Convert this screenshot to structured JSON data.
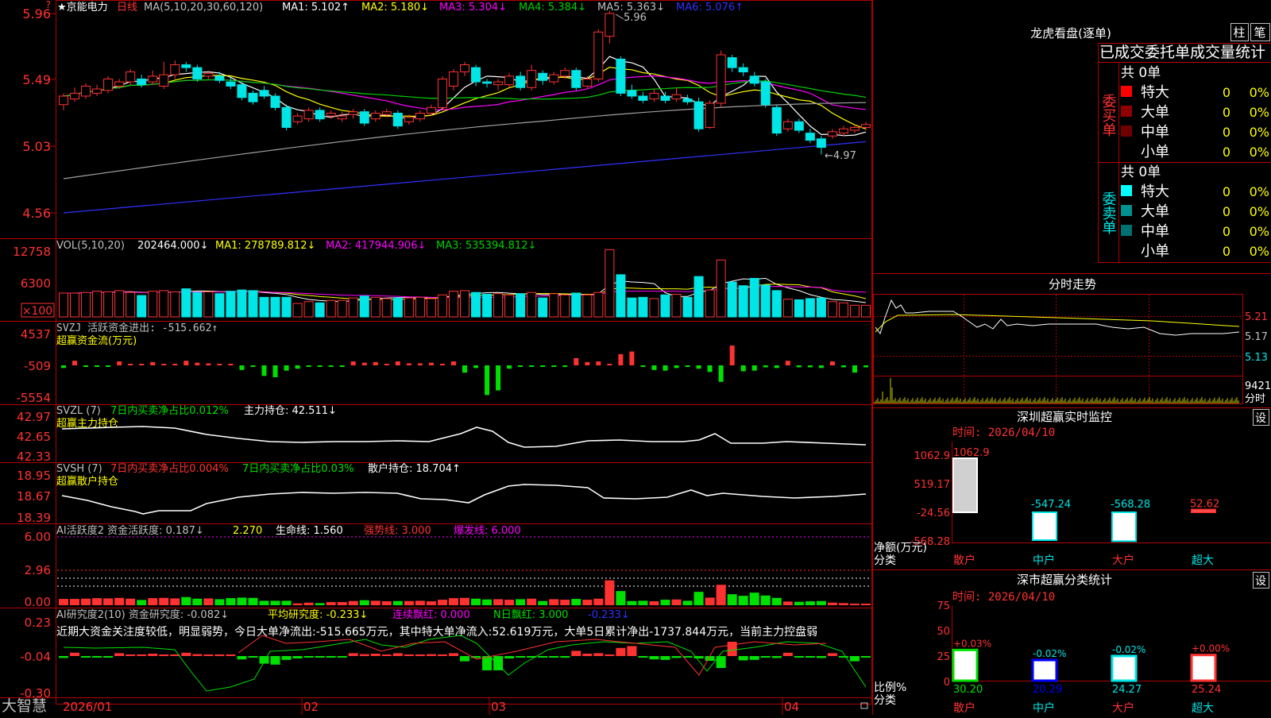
{
  "colors": {
    "up": "#ff3232",
    "down": "#00e5e5",
    "grid": "#b00000",
    "ma1": "#ffffff",
    "ma2": "#ffff00",
    "ma3": "#ff00ff",
    "ma4": "#00d000",
    "ma5": "#a0a0a0",
    "ma6": "#3030ff",
    "green": "#00e000"
  },
  "header": {
    "stock": "★京能电力",
    "period": "日线",
    "ma_def": "MA(5,10,20,30,60,120)",
    "ma1": "MA1: 5.102↑",
    "ma2": "MA2: 5.180↓",
    "ma3": "MA3: 5.304↓",
    "ma4": "MA4: 5.384↓",
    "ma5": "MA5: 5.363↓",
    "ma6": "MA6: 5.076↑"
  },
  "price_axis": [
    "5.96",
    "5.49",
    "5.03",
    "4.56"
  ],
  "price_marks": {
    "high": "5.96",
    "low": "←4.97"
  },
  "vol": {
    "def": "VOL(5,10,20)",
    "value": "202464.000↓",
    "ma1": "MA1: 278789.812↓",
    "ma2": "MA2: 417944.906↓",
    "ma3": "MA3: 535394.812↓",
    "axis": [
      "12758",
      "6300",
      "×100"
    ]
  },
  "svzj": {
    "label": "SVZJ  活跃资金进出: -515.662↑",
    "sub": "超赢资金流(万元)",
    "axis": [
      "4537",
      "-509",
      "-5554"
    ]
  },
  "svzl": {
    "label_a": "SVZL (7)",
    "label_b": "7日内买卖净占比0.012%",
    "label_c": "主力持仓: 42.511↓",
    "sub": "超赢主力持仓",
    "axis": [
      "42.97",
      "42.65",
      "42.33"
    ]
  },
  "svsh": {
    "label_a": "SVSH (7)",
    "label_b": "7日内买卖净占比0.004%",
    "label_c": "7日内买卖净占比0.03%",
    "label_d": "散户持仓: 18.704↑",
    "sub": "超赢散户持仓",
    "axis": [
      "18.95",
      "18.67",
      "18.39"
    ]
  },
  "ai1": {
    "label_a": "AI活跃度2 资金活跃度: 0.187↓",
    "label_b": "2.270",
    "label_c": "生命线: 1.560",
    "label_d": "强势线: 3.000",
    "label_e": "爆发线: 6.000",
    "axis": [
      "6.00",
      "2.96",
      "0.00"
    ]
  },
  "ai2": {
    "label_a": "AI研究度2(10) 资金研究度: -0.082↓",
    "label_b": "平均研究度: -0.233↓",
    "label_c": "连续飘红: 0.000",
    "label_d": "N日飘红: 3.000",
    "label_e": "-0.233↓",
    "commentary": "近期大资金关注度较低，明显弱势，今日大单净流出:-515.665万元，其中特大单净流入:52.619万元，大单5日累计净出-1737.844万元，当前主力控盘弱",
    "axis": [
      "0.23",
      "-0.04",
      "-0.30"
    ]
  },
  "date_axis": [
    "2026/01",
    "02",
    "03",
    "04"
  ],
  "brand": "大智慧",
  "right": {
    "lhb_title": "龙虎看盘(逐单)",
    "tab1": "柱",
    "tab2": "笔",
    "stats_header": "已成交委托单成交量统计",
    "buy_title": "委买单",
    "sell_title": "委卖单",
    "buy_total": "共 0单",
    "sell_total": "共 0单",
    "buy_rows": [
      {
        "label": "特大",
        "val": "0",
        "pct": "0%",
        "color": "#ff0000"
      },
      {
        "label": "大单",
        "val": "0",
        "pct": "0%",
        "color": "#900000"
      },
      {
        "label": "中单",
        "val": "0",
        "pct": "0%",
        "color": "#700000"
      },
      {
        "label": "小单",
        "val": "0",
        "pct": "0%",
        "color": ""
      }
    ],
    "sell_rows": [
      {
        "label": "特大",
        "val": "0",
        "pct": "0%",
        "color": "#00ffff"
      },
      {
        "label": "大单",
        "val": "0",
        "pct": "0%",
        "color": "#009090"
      },
      {
        "label": "中单",
        "val": "0",
        "pct": "0%",
        "color": "#007070"
      },
      {
        "label": "小单",
        "val": "0",
        "pct": "0%",
        "color": ""
      }
    ],
    "intraday_title": "分时走势",
    "intraday_axis": [
      "5.21",
      "5.17",
      "5.13"
    ],
    "intraday_vol": "9421",
    "intraday_tag": "分时",
    "monitor_title": "深圳超赢实时监控",
    "monitor_set": "设",
    "monitor_time": "时间: 2026/04/10",
    "monitor_axis": [
      "1062.9",
      "519.17",
      "-24.56",
      "-568.28"
    ],
    "monitor_ylabel": "净额(万元)",
    "monitor_xlabel": "分类",
    "monitor_values": [
      {
        "cat": "散户",
        "value": 1062.9,
        "label": "1062.9"
      },
      {
        "cat": "中户",
        "value": -547.24,
        "label": "-547.24"
      },
      {
        "cat": "大户",
        "value": -568.28,
        "label": "-568.28"
      },
      {
        "cat": "超大",
        "value": 52.62,
        "label": "52.62"
      }
    ],
    "class_title": "深市超赢分类统计",
    "class_set": "设",
    "class_time": "时间: 2026/04/10",
    "class_axis": [
      "75",
      "50",
      "25",
      "0"
    ],
    "class_ylabel": "比例%",
    "class_xlabel": "分类",
    "class_values": [
      {
        "cat": "散户",
        "value": 30.2,
        "label": "30.20",
        "delta": "+0.03%"
      },
      {
        "cat": "中户",
        "value": 20.29,
        "label": "20.29",
        "delta": "-0.02%"
      },
      {
        "cat": "大户",
        "value": 24.27,
        "label": "24.27",
        "delta": "-0.02%"
      },
      {
        "cat": "超大",
        "value": 25.24,
        "label": "25.24",
        "delta": "+0.00%"
      }
    ]
  },
  "chart_data": {
    "type": "candlestick",
    "dates": [
      "2026/01",
      "02",
      "03",
      "04"
    ],
    "ylim": [
      4.56,
      5.96
    ],
    "candles": [
      [
        5.32,
        5.38,
        5.28,
        5.4
      ],
      [
        5.36,
        5.4,
        5.34,
        5.44
      ],
      [
        5.38,
        5.45,
        5.36,
        5.47
      ],
      [
        5.4,
        5.43,
        5.38,
        5.46
      ],
      [
        5.42,
        5.5,
        5.4,
        5.52
      ],
      [
        5.45,
        5.48,
        5.43,
        5.5
      ],
      [
        5.48,
        5.55,
        5.46,
        5.57
      ],
      [
        5.5,
        5.46,
        5.44,
        5.53
      ],
      [
        5.48,
        5.52,
        5.46,
        5.56
      ],
      [
        5.45,
        5.53,
        5.43,
        5.62
      ],
      [
        5.53,
        5.6,
        5.5,
        5.63
      ],
      [
        5.6,
        5.58,
        5.55,
        5.62
      ],
      [
        5.58,
        5.5,
        5.48,
        5.6
      ],
      [
        5.52,
        5.54,
        5.5,
        5.56
      ],
      [
        5.52,
        5.49,
        5.47,
        5.55
      ],
      [
        5.48,
        5.45,
        5.43,
        5.51
      ],
      [
        5.46,
        5.37,
        5.35,
        5.48
      ],
      [
        5.4,
        5.34,
        5.32,
        5.42
      ],
      [
        5.42,
        5.38,
        5.36,
        5.45
      ],
      [
        5.38,
        5.3,
        5.28,
        5.4
      ],
      [
        5.3,
        5.16,
        5.14,
        5.32
      ],
      [
        5.2,
        5.24,
        5.18,
        5.26
      ],
      [
        5.22,
        5.28,
        5.2,
        5.3
      ],
      [
        5.28,
        5.22,
        5.2,
        5.3
      ],
      [
        5.24,
        5.26,
        5.22,
        5.28
      ],
      [
        5.22,
        5.24,
        5.2,
        5.27
      ],
      [
        5.25,
        5.27,
        5.22,
        5.29
      ],
      [
        5.27,
        5.19,
        5.17,
        5.29
      ],
      [
        5.22,
        5.26,
        5.2,
        5.28
      ],
      [
        5.25,
        5.27,
        5.23,
        5.29
      ],
      [
        5.26,
        5.17,
        5.15,
        5.28
      ],
      [
        5.2,
        5.23,
        5.18,
        5.25
      ],
      [
        5.22,
        5.26,
        5.2,
        5.28
      ],
      [
        5.26,
        5.3,
        5.24,
        5.32
      ],
      [
        5.3,
        5.5,
        5.28,
        5.52
      ],
      [
        5.45,
        5.55,
        5.42,
        5.57
      ],
      [
        5.55,
        5.6,
        5.52,
        5.62
      ],
      [
        5.58,
        5.48,
        5.45,
        5.6
      ],
      [
        5.48,
        5.47,
        5.44,
        5.5
      ],
      [
        5.46,
        5.48,
        5.42,
        5.5
      ],
      [
        5.46,
        5.52,
        5.44,
        5.54
      ],
      [
        5.52,
        5.44,
        5.42,
        5.55
      ],
      [
        5.44,
        5.56,
        5.42,
        5.6
      ],
      [
        5.54,
        5.49,
        5.46,
        5.56
      ],
      [
        5.48,
        5.53,
        5.46,
        5.55
      ],
      [
        5.52,
        5.56,
        5.5,
        5.58
      ],
      [
        5.56,
        5.44,
        5.42,
        5.58
      ],
      [
        5.45,
        5.5,
        5.43,
        5.52
      ],
      [
        5.5,
        5.83,
        5.48,
        5.85
      ],
      [
        5.8,
        5.96,
        5.75,
        5.98
      ],
      [
        5.64,
        5.4,
        5.38,
        5.66
      ],
      [
        5.42,
        5.38,
        5.36,
        5.46
      ],
      [
        5.38,
        5.35,
        5.33,
        5.41
      ],
      [
        5.36,
        5.4,
        5.34,
        5.43
      ],
      [
        5.38,
        5.35,
        5.33,
        5.41
      ],
      [
        5.36,
        5.39,
        5.34,
        5.44
      ],
      [
        5.36,
        5.34,
        5.32,
        5.39
      ],
      [
        5.34,
        5.15,
        5.13,
        5.37
      ],
      [
        5.16,
        5.33,
        5.15,
        5.35
      ],
      [
        5.33,
        5.67,
        5.3,
        5.7
      ],
      [
        5.65,
        5.58,
        5.55,
        5.67
      ],
      [
        5.58,
        5.55,
        5.52,
        5.61
      ],
      [
        5.52,
        5.47,
        5.45,
        5.55
      ],
      [
        5.48,
        5.32,
        5.3,
        5.5
      ],
      [
        5.3,
        5.12,
        5.1,
        5.32
      ],
      [
        5.15,
        5.2,
        5.13,
        5.22
      ],
      [
        5.2,
        5.14,
        5.12,
        5.22
      ],
      [
        5.12,
        5.07,
        5.05,
        5.15
      ],
      [
        5.08,
        5.02,
        4.97,
        5.1
      ],
      [
        5.1,
        5.13,
        5.08,
        5.15
      ],
      [
        5.12,
        5.15,
        5.1,
        5.17
      ],
      [
        5.14,
        5.16,
        5.12,
        5.18
      ],
      [
        5.16,
        5.18,
        5.14,
        5.2
      ]
    ],
    "volume": [
      3.9,
      3.9,
      4.0,
      4.2,
      4.1,
      4.3,
      4.0,
      3.5,
      4.2,
      4.3,
      4.1,
      4.6,
      4.0,
      4.1,
      3.8,
      4.2,
      4.4,
      4.3,
      3.2,
      3.2,
      3.2,
      2.2,
      2.5,
      2.3,
      2.7,
      2.7,
      3.1,
      3.4,
      3.2,
      3.0,
      3.1,
      3.1,
      3.2,
      3.0,
      3.6,
      4.2,
      4.3,
      4.0,
      3.7,
      3.8,
      3.6,
      3.8,
      4.0,
      3.1,
      3.8,
      3.6,
      3.9,
      3.6,
      4.0,
      11.0,
      6.9,
      3.1,
      3.2,
      3.0,
      3.6,
      3.7,
      3.2,
      6.6,
      4.4,
      9.3,
      5.7,
      5.1,
      6.3,
      5.2,
      4.3,
      2.9,
      2.8,
      3.0,
      3.1,
      2.5,
      2.3,
      1.9,
      1.9
    ],
    "flow": [
      -400,
      700,
      -100,
      -200,
      -100,
      600,
      200,
      100,
      500,
      100,
      100,
      700,
      400,
      300,
      100,
      100,
      -700,
      -100,
      -1600,
      -1800,
      -800,
      -500,
      -200,
      -100,
      -100,
      -100,
      600,
      400,
      500,
      100,
      600,
      300,
      300,
      400,
      200,
      600,
      -1100,
      -400,
      -4500,
      -3800,
      -500,
      -200,
      -200,
      -100,
      -100,
      -100,
      1100,
      500,
      600,
      200,
      1700,
      2100,
      -200,
      -700,
      -800,
      -400,
      -200,
      -500,
      -1000,
      -2500,
      3000,
      -900,
      -800,
      -300,
      -400,
      700,
      -300,
      -300,
      -400,
      600,
      -300,
      -1100,
      -300
    ]
  }
}
